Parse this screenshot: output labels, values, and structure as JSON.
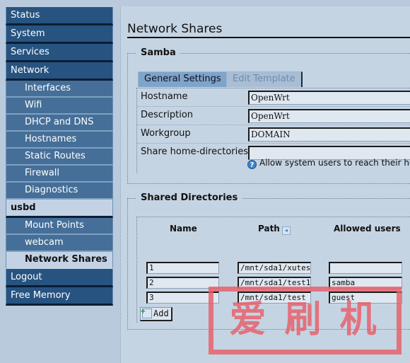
{
  "sidebar": {
    "top": [
      {
        "label": "Status"
      },
      {
        "label": "System"
      },
      {
        "label": "Services"
      },
      {
        "label": "Network"
      }
    ],
    "network_sub": [
      {
        "label": "Interfaces"
      },
      {
        "label": "Wifi"
      },
      {
        "label": "DHCP and DNS"
      },
      {
        "label": "Hostnames"
      },
      {
        "label": "Static Routes"
      },
      {
        "label": "Firewall"
      },
      {
        "label": "Diagnostics"
      }
    ],
    "usbd": {
      "label": "usbd"
    },
    "usbd_sub": [
      {
        "label": "Mount Points"
      },
      {
        "label": "webcam"
      },
      {
        "label": "Network Shares"
      }
    ],
    "bottom": [
      {
        "label": "Logout"
      },
      {
        "label": "Free Memory"
      }
    ]
  },
  "page": {
    "title": "Network Shares"
  },
  "samba": {
    "legend": "Samba",
    "tabs": [
      {
        "label": "General Settings",
        "active": true
      },
      {
        "label": "Edit Template",
        "active": false
      }
    ],
    "fields": [
      {
        "label": "Hostname",
        "value": "OpenWrt"
      },
      {
        "label": "Description",
        "value": "OpenWrt"
      },
      {
        "label": "Workgroup",
        "value": "DOMAIN"
      },
      {
        "label": "Share home-directories",
        "value": ""
      }
    ],
    "help_text": "Allow system users to reach their ho"
  },
  "shared": {
    "legend": "Shared Directories",
    "columns": [
      "Name",
      "Path",
      "Allowed users"
    ],
    "rows": [
      {
        "name": "1",
        "path": "/mnt/sda1/xutes",
        "users": ""
      },
      {
        "name": "2",
        "path": "/mnt/sda1/test1",
        "users": "samba"
      },
      {
        "name": "3",
        "path": "/mnt/sda1/test",
        "users": "guest"
      }
    ],
    "add_label": "Add"
  },
  "watermark": {
    "text": "爱刷机"
  },
  "colors": {
    "nav_dark": "#275380",
    "nav_sub": "#456f98",
    "nav_active": "#c3d3e5",
    "content_bg": "#c5d4e3",
    "watermark": "#e85a64"
  }
}
